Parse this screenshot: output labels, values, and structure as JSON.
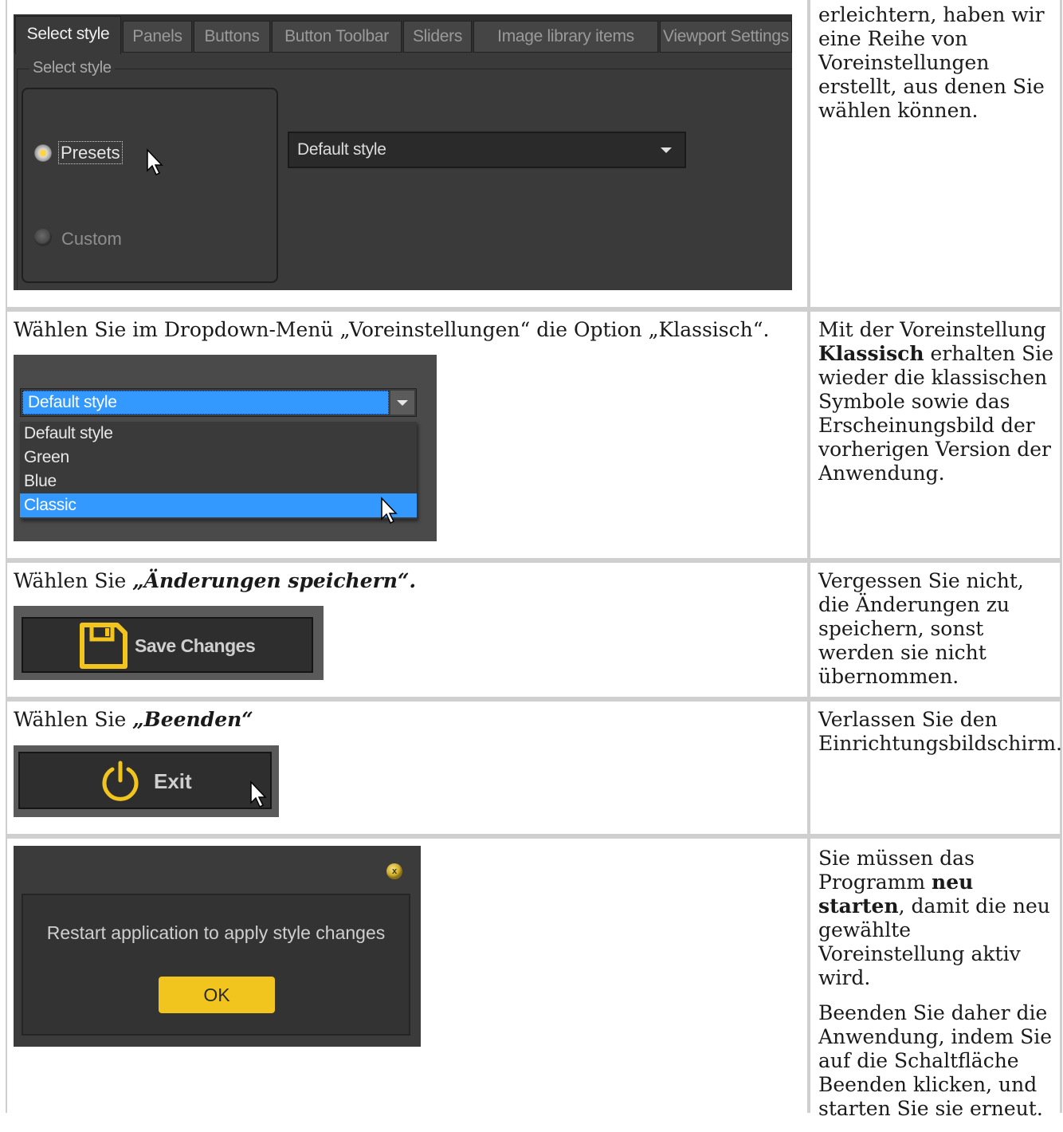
{
  "row1": {
    "app": {
      "tabs": [
        "Select style",
        "Panels",
        "Buttons",
        "Button Toolbar",
        "Sliders",
        "Image library items",
        "Viewport Settings"
      ],
      "group_label": "Select style",
      "radio_presets": "Presets",
      "radio_custom": "Custom",
      "combo_value": "Default style"
    },
    "side_text": "erleichtern, haben wir eine Reihe von Voreinstellungen erstellt, aus denen Sie wählen können."
  },
  "row2": {
    "instruction": "Wählen Sie im Dropdown-Menü „Voreinstellungen“ die Option „Klassisch“.",
    "dropdown": {
      "selected": "Default style",
      "options": [
        "Default style",
        "Green",
        "Blue",
        "Classic"
      ],
      "highlighted": "Classic"
    },
    "side_pre": "Mit der Voreinstellung ",
    "side_bold": "Klassisch",
    "side_post": " erhalten Sie wieder die klassischen Symbole sowie das Erscheinungsbild der vorherigen Version der Anwendung."
  },
  "row3": {
    "instruction_pre": "Wählen Sie ",
    "instruction_emph": "„Änderungen speichern“.",
    "button_label": "Save Changes",
    "side_text": "Vergessen Sie nicht, die Änderungen zu speichern, sonst werden sie nicht übernommen."
  },
  "row4": {
    "instruction_pre": "Wählen Sie ",
    "instruction_emph": "„Beenden“",
    "button_label": "Exit",
    "side_text": "Verlassen Sie den Einrichtungsbildschirm."
  },
  "row5": {
    "dialog_message": "Restart application to apply style changes",
    "ok_label": "OK",
    "close_glyph": "x",
    "side_p1_pre": "Sie müssen das Programm ",
    "side_p1_bold": "neu starten",
    "side_p1_post": ", damit die neu gewählte Voreinstellung aktiv wird.",
    "side_p2": "Beenden Sie daher die Anwendung, indem Sie auf die Schaltfläche Beenden klicken, und starten Sie sie erneut."
  },
  "colors": {
    "accent_yellow": "#f2c51e",
    "selection_blue": "#3399ff",
    "dark_panel": "#3a3a3a"
  }
}
